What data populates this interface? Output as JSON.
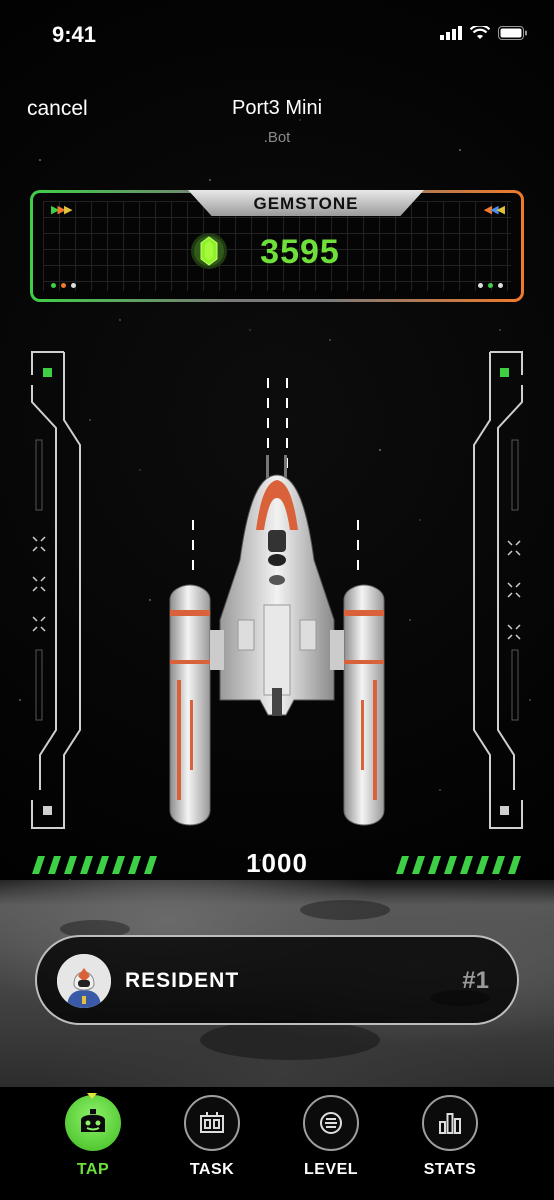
{
  "status_bar": {
    "time": "9:41"
  },
  "header": {
    "cancel_label": "cancel",
    "title": "Port3 Mini",
    "subtitle": ".Bot"
  },
  "gemstone": {
    "label": "GEMSTONE",
    "value": "3595",
    "icon": "green-gem-icon"
  },
  "tap": {
    "count": "1000"
  },
  "resident": {
    "label": "RESIDENT",
    "rank": "#1",
    "avatar": "astronaut-avatar"
  },
  "nav": {
    "items": [
      {
        "label": "TAP",
        "icon": "tap-icon",
        "active": true
      },
      {
        "label": "TASK",
        "icon": "task-icon",
        "active": false
      },
      {
        "label": "LEVEL",
        "icon": "level-icon",
        "active": false
      },
      {
        "label": "STATS",
        "icon": "stats-icon",
        "active": false
      }
    ]
  },
  "colors": {
    "accent_green": "#6fe03a",
    "accent_orange": "#f07a2a"
  }
}
